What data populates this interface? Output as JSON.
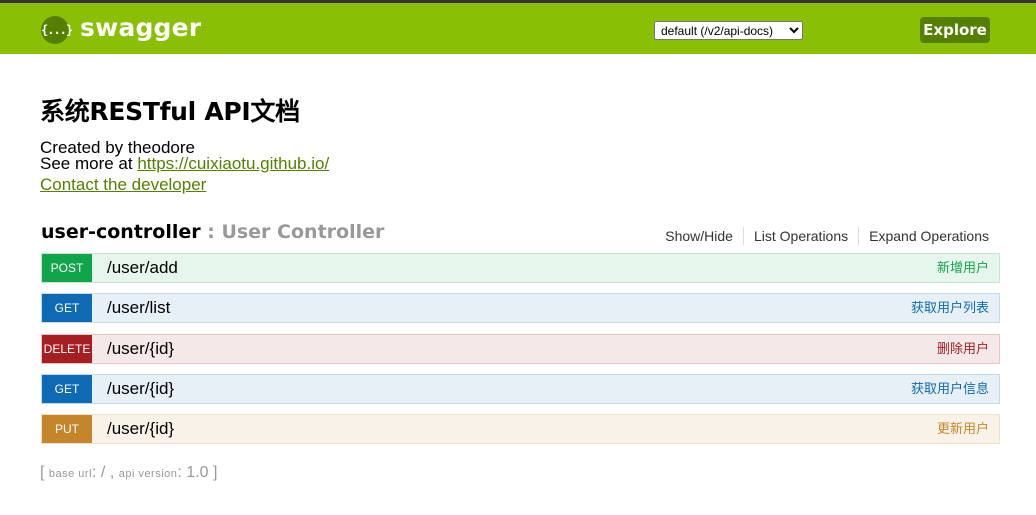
{
  "header": {
    "logo_icon": "{...}",
    "logo_text": "swagger",
    "spec_select_value": "default (/v2/api-docs)",
    "explore_label": "Explore"
  },
  "info": {
    "title": "系统RESTful API文档",
    "created_by": "Created by theodore",
    "see_more_prefix": "See more at ",
    "see_more_link": "https://cuixiaotu.github.io/",
    "contact": "Contact the developer"
  },
  "resource": {
    "name": "user-controller",
    "separator": " : ",
    "description": "User Controller",
    "links": [
      "Show/Hide",
      "List Operations",
      "Expand Operations"
    ]
  },
  "operations": [
    {
      "method": "POST",
      "path": "/user/add",
      "summary": "新增用户",
      "color": "#10a54a",
      "bg": "#e7f6ec",
      "border": "#c3e8d1",
      "text_color": "#10a54a"
    },
    {
      "method": "GET",
      "path": "/user/list",
      "summary": "获取用户列表",
      "color": "#0f6ab4",
      "bg": "#e7f0f7",
      "border": "#c3d9ec",
      "text_color": "#0f6ab4"
    },
    {
      "method": "DELETE",
      "path": "/user/{id}",
      "summary": "删除用户",
      "color": "#a41e22",
      "bg": "#f5e8e8",
      "border": "#e8c6c7",
      "text_color": "#a41e22"
    },
    {
      "method": "GET",
      "path": "/user/{id}",
      "summary": "获取用户信息",
      "color": "#0f6ab4",
      "bg": "#e7f0f7",
      "border": "#c3d9ec",
      "text_color": "#0f6ab4"
    },
    {
      "method": "PUT",
      "path": "/user/{id}",
      "summary": "更新用户",
      "color": "#c5862b",
      "bg": "#f9f2e9",
      "border": "#f0e0ca",
      "text_color": "#c5862b"
    }
  ],
  "footer": {
    "open": "[ ",
    "base_url_label": "base url",
    "base_url_value": ": / , ",
    "api_version_label": "api version",
    "api_version_value": ": 1.0 ",
    "close": "]"
  },
  "colors": {
    "header_bg": "#89bf04",
    "brand_dark": "#547f00"
  }
}
